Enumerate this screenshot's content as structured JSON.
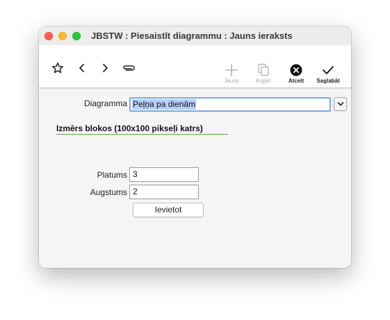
{
  "window": {
    "title": "JBSTW : Piesaistīt diagrammu : Jauns ieraksts"
  },
  "toolbar": {
    "new_label": "Jauns",
    "copy_label": "Kopēt",
    "cancel_label": "Atcelt",
    "save_label": "Saglabāt"
  },
  "form": {
    "diagram_label": "Diagramma",
    "diagram_value": "Peļņa pa dienām",
    "section_title": "Izmērs blokos (100x100 pikseļi katrs)",
    "width_label": "Platums",
    "width_value": "3",
    "height_label": "Augstums",
    "height_value": "2",
    "insert_button": "Ievietot"
  },
  "colors": {
    "section_line": "#5cae45",
    "selection": "#b6d0f7",
    "focus_ring": "#7aa7ee"
  }
}
